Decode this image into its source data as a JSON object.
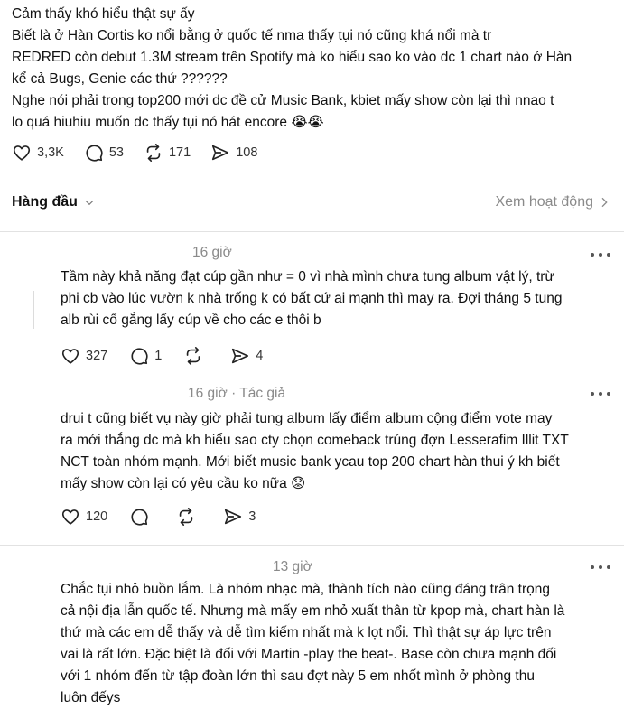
{
  "post": {
    "lines": [
      "Cảm thấy khó hiểu thật sự ấy",
      "Biết là ở Hàn Cortis ko nổi bằng ở quốc tế nma thấy tụi nó cũng khá nổi mà tr",
      "REDRED còn debut 1.3M stream trên Spotify mà ko hiểu sao ko vào dc 1 chart nào ở Hàn",
      "kể cả Bugs, Genie các thứ ??????",
      "Nghe nói phải trong top200 mới dc đề cử Music Bank, kbiet mấy show còn lại thì nnao t",
      "lo quá hiuhiu muốn dc thấy tụi nó hát encore 😭😭"
    ],
    "likes": "3,3K",
    "comments": "53",
    "reposts": "171",
    "shares": "108"
  },
  "sort": {
    "label": "Hàng đầu",
    "view_activity": "Xem hoạt động"
  },
  "replies": [
    {
      "time": "16 giờ",
      "lines": [
        "Tầm này khả năng đạt cúp gần như = 0 vì nhà mình chưa tung album vật lý, trừ",
        "phi cb vào lúc vườn k nhà trống k có bất cứ ai mạnh thì may ra. Đợi tháng 5 tung",
        "alb rùi cố gắng lấy cúp về cho các e thôi b"
      ],
      "likes": "327",
      "comments": "1",
      "reposts": "",
      "shares": "4"
    },
    {
      "time": "16 giờ · Tác giả",
      "lines": [
        "drui t cũng biết vụ này giờ phải tung album lấy điểm album cộng điểm vote may",
        "ra mới thắng dc mà kh hiểu sao cty chọn comeback trúng đợn Lesserafim Illit TXT",
        "NCT toàn nhóm mạnh. Mới biết music bank ycau top 200 chart hàn thui ý kh biết",
        "mấy show còn lại có yêu cầu ko nữa 😟"
      ],
      "likes": "120",
      "comments": "",
      "reposts": "",
      "shares": "3"
    },
    {
      "time": "13 giờ",
      "lines": [
        "Chắc tụi nhỏ buồn lắm. Là nhóm nhạc mà, thành tích nào cũng đáng trân trọng",
        "cả nội địa lẫn quốc tế. Nhưng mà mấy em nhỏ xuất thân từ kpop mà, chart hàn là",
        "thứ mà các em dễ thấy và dễ tìm kiếm nhất mà k lọt nổi. Thì thật sự áp lực trên",
        "vai là rất lớn. Đặc biệt là đối với Martin -play the beat-. Base còn chưa mạnh đối",
        "với 1 nhóm đến từ tập đoàn lớn thì sau đợt này 5 em nhốt mình ở phòng thu",
        "luôn đếys"
      ]
    }
  ],
  "icons": {
    "like": "heart-icon",
    "comment": "comment-bubble-icon",
    "repost": "repost-arrows-icon",
    "share": "send-icon",
    "more": "more-dots-icon",
    "sort": "chevron-down-icon",
    "view_activity": "chevron-right-icon"
  }
}
